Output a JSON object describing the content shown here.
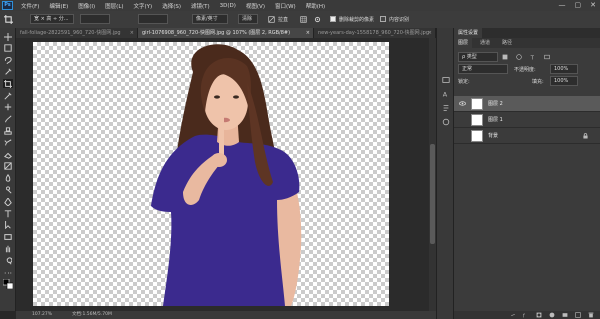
{
  "app": {
    "logo": "Ps",
    "menu": [
      "文件(F)",
      "编辑(E)",
      "图像(I)",
      "图层(L)",
      "文字(Y)",
      "选择(S)",
      "滤镜(T)",
      "3D(D)",
      "视图(V)",
      "窗口(W)",
      "帮助(H)"
    ],
    "window_controls": [
      "—",
      "▢",
      "✕"
    ]
  },
  "options": {
    "tool_icon": "move-icon",
    "preset_value": "宽 × 高 ÷ 分...",
    "field2": "",
    "field3": "",
    "resample": "像素/英寸",
    "clear_label": "清除",
    "straighten_label": "拉直",
    "delete_cropped_label": "删除裁剪的像素",
    "content_aware_label": "内容识别"
  },
  "tabs": [
    {
      "label": "fall-foliage-2822591_960_720-快图网.jpg",
      "active": false
    },
    {
      "label": "girl-1076908_960_720-快图网.jpg @ 107% (图层 2, RGB/8#)",
      "active": true
    },
    {
      "label": "new-years-day-1558178_960_720-快图网.jpg",
      "active": false
    }
  ],
  "tools": [
    "move-icon",
    "marquee-icon",
    "lasso-icon",
    "quick-select-icon",
    "crop-icon",
    "eyedropper-icon",
    "healing-icon",
    "brush-icon",
    "stamp-icon",
    "history-brush-icon",
    "eraser-icon",
    "gradient-icon",
    "blur-icon",
    "dodge-icon",
    "pen-icon",
    "type-icon",
    "path-select-icon",
    "shape-icon",
    "hand-icon",
    "zoom-icon",
    "more-icon",
    "color-swatch-icon"
  ],
  "status": {
    "zoom": "107.27%",
    "doc": "文档:1.56M/5.70M"
  },
  "panel": {
    "header_tab": "属性设置",
    "tabs": [
      "图层",
      "通道",
      "路径"
    ],
    "filter_label": "ρ 类型",
    "blend_mode": "正常",
    "opacity_label": "不透明度:",
    "opacity_value": "100%",
    "lock_label": "锁定:",
    "fill_label": "填充:",
    "fill_value": "100%",
    "layers": [
      {
        "name": "图层 2",
        "selected": true,
        "visible": true,
        "locked": false
      },
      {
        "name": "图层 1",
        "selected": false,
        "visible": false,
        "locked": false
      },
      {
        "name": "背景",
        "selected": false,
        "visible": false,
        "locked": true
      }
    ]
  },
  "colors": {
    "accent": "#2f8fd8",
    "shirt": "#3b2a8e"
  }
}
